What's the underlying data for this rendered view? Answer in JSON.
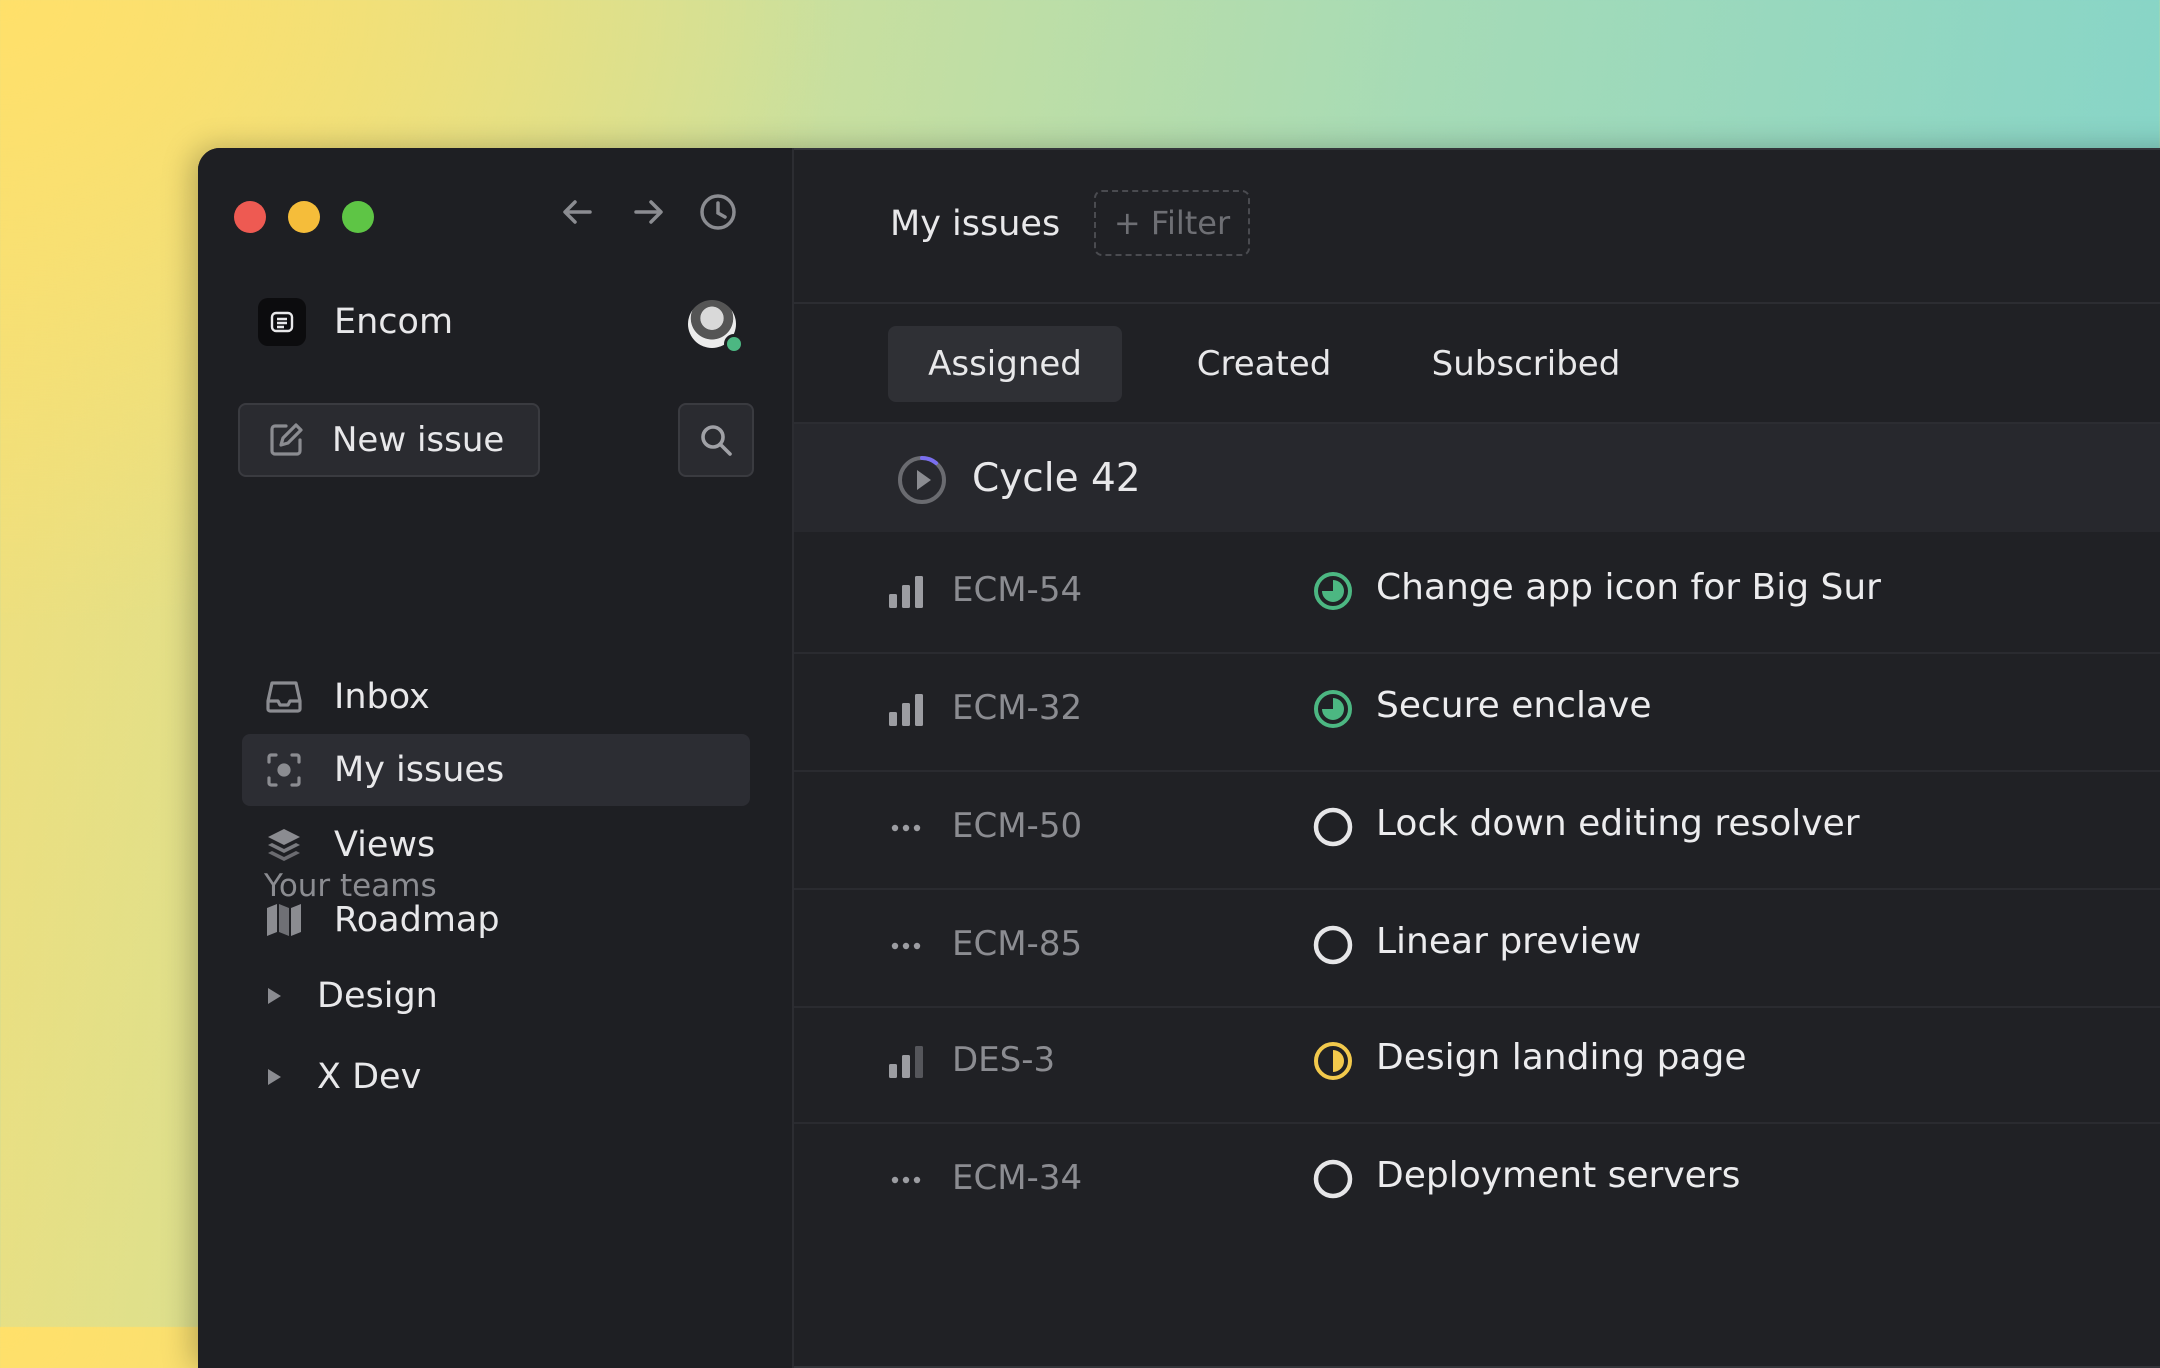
{
  "sidebar": {
    "workspace_name": "Encom",
    "new_issue_label": "New issue",
    "nav": [
      {
        "label": "Inbox",
        "icon": "inbox-icon"
      },
      {
        "label": "My issues",
        "icon": "my-issues-icon",
        "active": true
      },
      {
        "label": "Views",
        "icon": "layers-icon"
      },
      {
        "label": "Roadmap",
        "icon": "map-icon"
      }
    ],
    "teams_heading": "Your teams",
    "teams": [
      {
        "label": "Design"
      },
      {
        "label": "X Dev"
      }
    ]
  },
  "header": {
    "title": "My issues",
    "filter_label": "+ Filter"
  },
  "tabs": [
    {
      "label": "Assigned",
      "active": true
    },
    {
      "label": "Created"
    },
    {
      "label": "Subscribed"
    }
  ],
  "cycle": {
    "label": "Cycle 42"
  },
  "issues": [
    {
      "priority": "bars",
      "id": "ECM-54",
      "status": "in-progress",
      "title": "Change app icon for Big Sur"
    },
    {
      "priority": "bars",
      "id": "ECM-32",
      "status": "in-progress",
      "title": "Secure enclave"
    },
    {
      "priority": "none",
      "id": "ECM-50",
      "status": "todo",
      "title": "Lock down editing resolver"
    },
    {
      "priority": "none",
      "id": "ECM-85",
      "status": "todo",
      "title": "Linear preview"
    },
    {
      "priority": "bars",
      "id": "DES-3",
      "status": "in-review",
      "title": "Design landing page"
    },
    {
      "priority": "none",
      "id": "ECM-34",
      "status": "todo",
      "title": "Deployment servers"
    }
  ],
  "colors": {
    "accent_green": "#4cb782",
    "accent_yellow": "#f2c94c",
    "traffic_red": "#ee5a52",
    "traffic_yellow": "#f5bd3a",
    "traffic_green": "#5ec545"
  }
}
